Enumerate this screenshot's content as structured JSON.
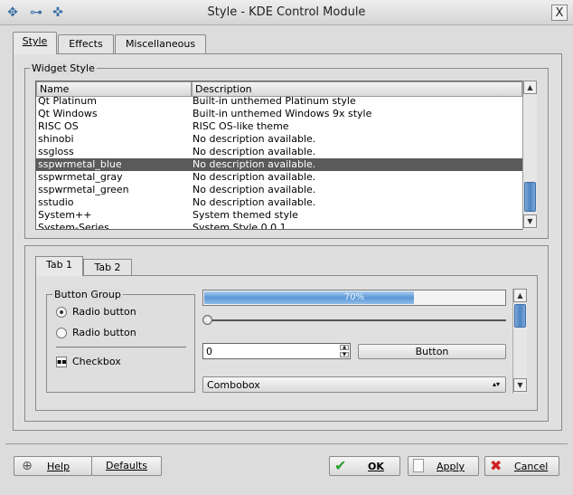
{
  "window": {
    "title": "Style - KDE Control Module",
    "close_glyph": "X"
  },
  "top_tabs": [
    {
      "label": "Style",
      "active": true
    },
    {
      "label": "Effects",
      "active": false
    },
    {
      "label": "Miscellaneous",
      "active": false
    }
  ],
  "widget_style": {
    "group_title": "Widget Style",
    "columns": [
      "Name",
      "Description"
    ],
    "rows": [
      {
        "name": "Qt Platinum",
        "description": "Built-in unthemed Platinum style"
      },
      {
        "name": "Qt Windows",
        "description": "Built-in unthemed Windows 9x style"
      },
      {
        "name": "RISC OS",
        "description": "RISC OS-like theme"
      },
      {
        "name": "shinobi",
        "description": "No description available."
      },
      {
        "name": "ssgloss",
        "description": "No description available."
      },
      {
        "name": "sspwrmetal_blue",
        "description": "No description available.",
        "selected": true
      },
      {
        "name": "sspwrmetal_gray",
        "description": "No description available."
      },
      {
        "name": "sspwrmetal_green",
        "description": "No description available."
      },
      {
        "name": "sstudio",
        "description": "No description available."
      },
      {
        "name": "System++",
        "description": "System themed style"
      },
      {
        "name": "System-Series",
        "description": "System Style 0.0.1"
      }
    ]
  },
  "preview": {
    "tabs": [
      {
        "label": "Tab 1",
        "active": true
      },
      {
        "label": "Tab 2",
        "active": false
      }
    ],
    "button_group": {
      "title": "Button Group",
      "radio1": "Radio button",
      "radio2": "Radio button",
      "checkbox": "Checkbox"
    },
    "progress": {
      "value": 0.7,
      "label": "70%"
    },
    "slider": {
      "value": 0
    },
    "spinbox": {
      "value": "0"
    },
    "button_label": "Button",
    "combobox_value": "Combobox"
  },
  "footer": {
    "help": "Help",
    "defaults": "Defaults",
    "ok": "OK",
    "apply": "Apply",
    "cancel": "Cancel"
  },
  "colors": {
    "accent": "#4d84c2",
    "selection": "#5a5a5a",
    "ok_green": "#2e9e2e",
    "cancel_red": "#d02020"
  },
  "icons": [
    "app-icon",
    "minimize-icon",
    "sticky-icon",
    "close-icon",
    "help-icon",
    "apply-icon",
    "ok-icon",
    "cancel-icon",
    "arrow-up-icon",
    "arrow-down-icon"
  ]
}
